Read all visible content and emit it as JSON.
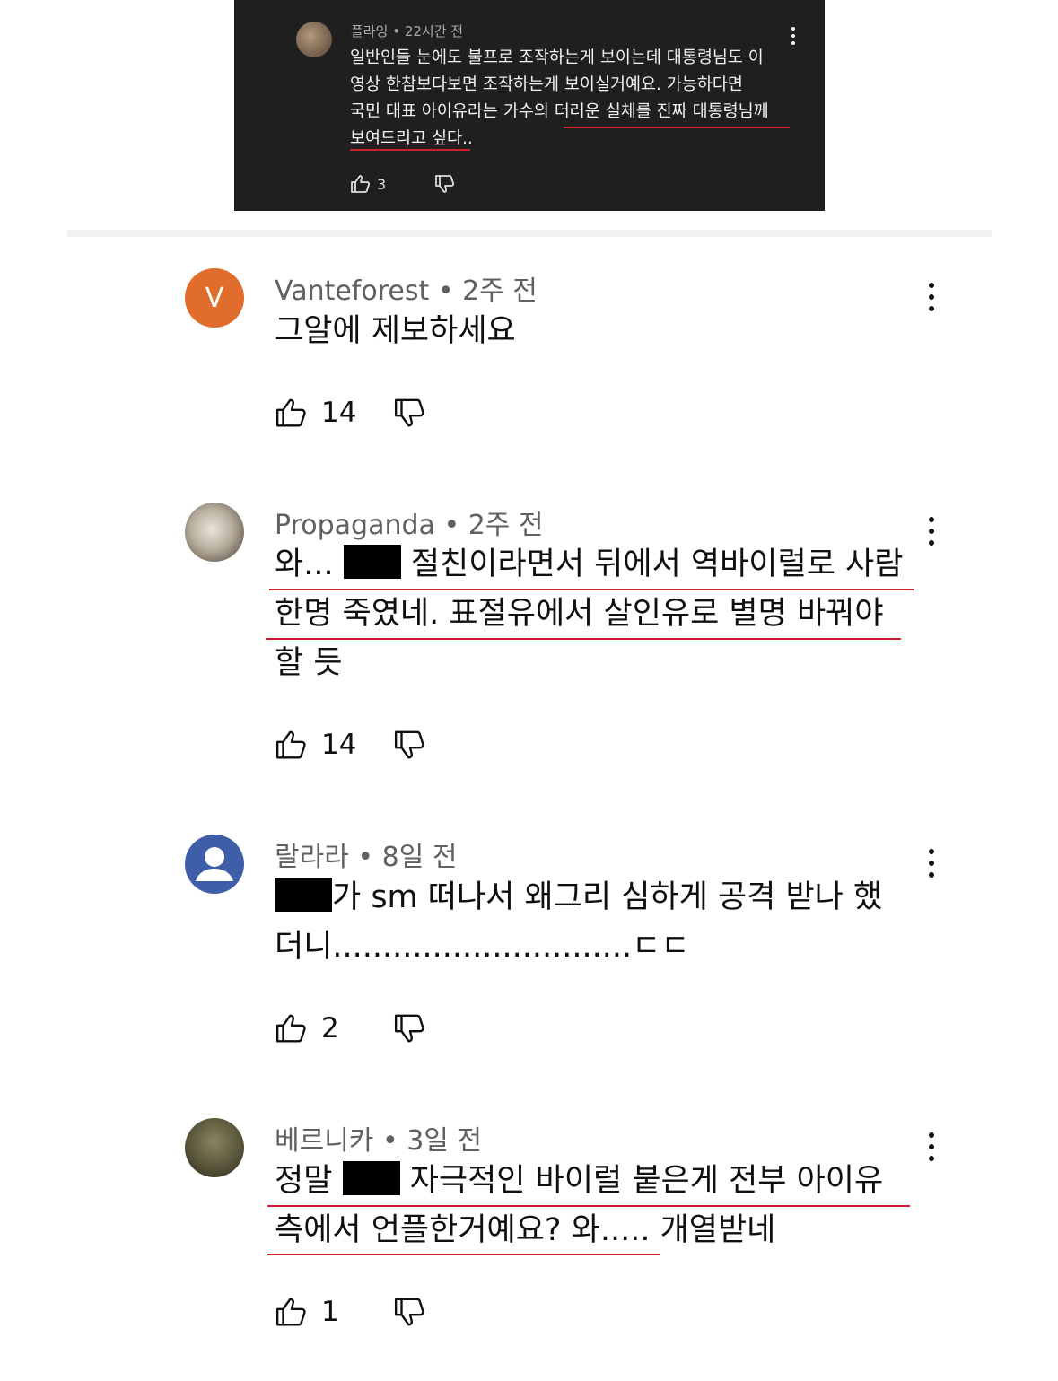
{
  "reply": {
    "author": "플라잉",
    "time": "22시간 전",
    "line1": "일반인들 눈에도 불프로 조작하는게 보이는데 대통령님도 이",
    "line2": "영상 한참보다보면 조작하는게 보이실거예요. 가능하다면",
    "line3": "국민 대표 아이유라는 가수의 더러운 실체를 진짜 대통령님께",
    "line4": "보여드리고 싶다..",
    "likes": "3"
  },
  "comments": [
    {
      "avatar_letter": "V",
      "author": "Vanteforest",
      "time": "2주 전",
      "line1": "그알에 제보하세요",
      "likes": "14"
    },
    {
      "author": "Propaganda",
      "time": "2주 전",
      "line1_pre": "와...",
      "line1_post": "절친이라면서 뒤에서 역바이럴로 사람",
      "line2": "한명 죽였네. 표절유에서 살인유로 별명 바꿔야",
      "line3": "할 듯",
      "likes": "14"
    },
    {
      "author": "랄라라",
      "time": "8일 전",
      "line1_post": "가 sm 떠나서 왜그리 심하게 공격 받나 했",
      "line2": "더니..............................ㄷㄷ",
      "likes": "2"
    },
    {
      "author": "베르니카",
      "time": "3일 전",
      "line1_pre": "정말",
      "line1_post": "자극적인 바이럴 붙은게 전부 아이유",
      "line2": "측에서 언플한거예요? 와..... 개열받네",
      "likes": "1"
    }
  ],
  "separator": "•",
  "colors": {
    "underline": "#cc2030",
    "avatar_v": "#e06d2c",
    "avatar_user": "#3e5fa8",
    "dark_bg": "#1f1f1f"
  },
  "icons": [
    "thumbs-up-icon",
    "thumbs-down-icon",
    "more-vert-icon"
  ]
}
